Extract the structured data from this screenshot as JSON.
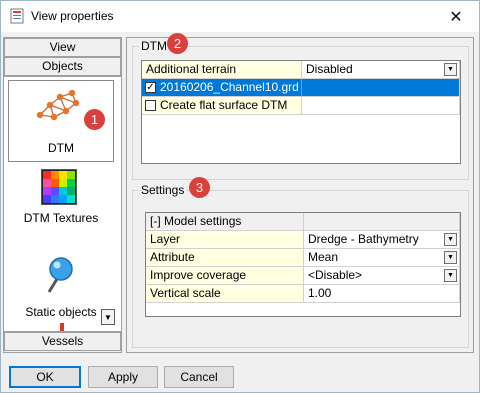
{
  "window": {
    "title": "View properties",
    "close_icon": "close-icon"
  },
  "left_panel": {
    "view_label": "View",
    "objects_label": "Objects",
    "vessels_label": "Vessels",
    "items": [
      {
        "label": "DTM",
        "icon": "dtm-mesh-icon",
        "selected": true,
        "badge": "1"
      },
      {
        "label": "DTM Textures",
        "icon": "dtm-textures-icon",
        "selected": false
      },
      {
        "label": "Static objects",
        "icon": "static-objects-pin-icon",
        "selected": false
      }
    ]
  },
  "dtm_group": {
    "title": "DTM",
    "badge": "2",
    "header": {
      "name": "Additional terrain",
      "value": "Disabled"
    },
    "rows": [
      {
        "label": "20160206_Channel10.grd",
        "checked": true,
        "selected": true
      },
      {
        "label": "Create flat surface DTM",
        "checked": false,
        "selected": false
      }
    ]
  },
  "settings_group": {
    "title": "Settings",
    "badge": "3",
    "section": "[-] Model settings",
    "rows": [
      {
        "name": "Layer",
        "value": "Dredge - Bathymetry",
        "combo": true
      },
      {
        "name": "Attribute",
        "value": "Mean",
        "combo": true
      },
      {
        "name": "Improve coverage",
        "value": "<Disable>",
        "combo": true
      },
      {
        "name": "Vertical scale",
        "value": "1.00",
        "combo": false
      }
    ]
  },
  "buttons": {
    "ok": "OK",
    "apply": "Apply",
    "cancel": "Cancel"
  },
  "colors": {
    "selection": "#0078d7",
    "badge": "#d9413c",
    "property_cell": "#ffffe1"
  }
}
